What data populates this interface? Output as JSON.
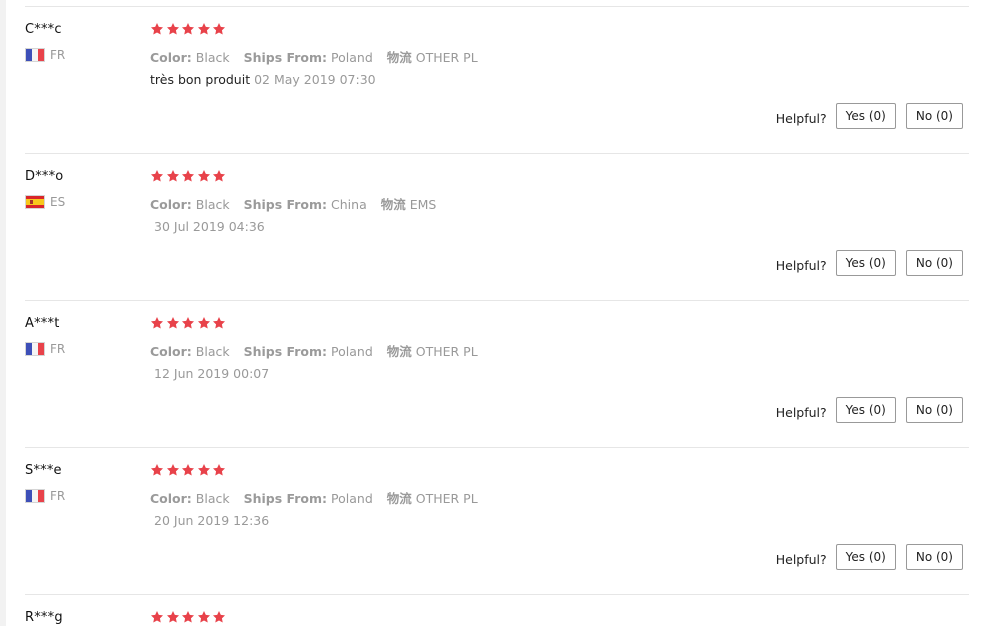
{
  "helpful_label": "Helpful?",
  "colors": {
    "star": "#e8424a",
    "muted_text": "#999999",
    "separator": "#e6e6e6"
  },
  "reviews": [
    {
      "user": "C***c",
      "country": "FR",
      "flag_icon": "flag-fr-icon",
      "rating": 5,
      "attributes": [
        {
          "label": "Color:",
          "value": "Black"
        },
        {
          "label": "Ships From:",
          "value": "Poland"
        },
        {
          "label": "物流",
          "value": "OTHER PL"
        }
      ],
      "text": "très bon produit",
      "date": "02 May 2019 07:30",
      "yes": "Yes (0)",
      "no": "No (0)"
    },
    {
      "user": "D***o",
      "country": "ES",
      "flag_icon": "flag-es-icon",
      "rating": 5,
      "attributes": [
        {
          "label": "Color:",
          "value": "Black"
        },
        {
          "label": "Ships From:",
          "value": "China"
        },
        {
          "label": "物流",
          "value": "EMS"
        }
      ],
      "text": "",
      "date": "30 Jul 2019 04:36",
      "yes": "Yes (0)",
      "no": "No (0)"
    },
    {
      "user": "A***t",
      "country": "FR",
      "flag_icon": "flag-fr-icon",
      "rating": 5,
      "attributes": [
        {
          "label": "Color:",
          "value": "Black"
        },
        {
          "label": "Ships From:",
          "value": "Poland"
        },
        {
          "label": "物流",
          "value": "OTHER PL"
        }
      ],
      "text": "",
      "date": "12 Jun 2019 00:07",
      "yes": "Yes (0)",
      "no": "No (0)"
    },
    {
      "user": "S***e",
      "country": "FR",
      "flag_icon": "flag-fr-icon",
      "rating": 5,
      "attributes": [
        {
          "label": "Color:",
          "value": "Black"
        },
        {
          "label": "Ships From:",
          "value": "Poland"
        },
        {
          "label": "物流",
          "value": "OTHER PL"
        }
      ],
      "text": "",
      "date": "20 Jun 2019 12:36",
      "yes": "Yes (0)",
      "no": "No (0)"
    },
    {
      "user": "R***g",
      "country": "",
      "flag_icon": "",
      "rating": 5,
      "attributes": [],
      "text": "",
      "date": "",
      "yes": "",
      "no": ""
    }
  ]
}
